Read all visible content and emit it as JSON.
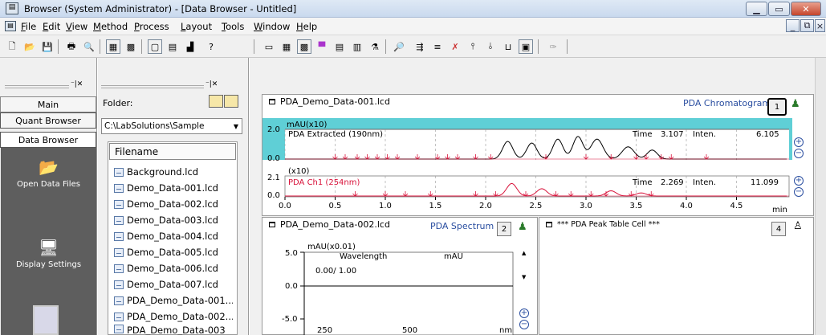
{
  "window": {
    "title": "Browser (System Administrator) - [Data Browser - Untitled]"
  },
  "menu": [
    "File",
    "Edit",
    "View",
    "Method",
    "Process",
    "Layout",
    "Tools",
    "Window",
    "Help"
  ],
  "left_nav": {
    "tabs": [
      "Main",
      "Quant Browser",
      "Data Browser"
    ],
    "buttons": [
      "Open Data Files",
      "Display Settings"
    ]
  },
  "folder": {
    "label": "Folder:",
    "path": "C:\\LabSolutions\\Sample",
    "header": "Filename",
    "files": [
      "Background.lcd",
      "Demo_Data-001.lcd",
      "Demo_Data-002.lcd",
      "Demo_Data-003.lcd",
      "Demo_Data-004.lcd",
      "Demo_Data-005.lcd",
      "Demo_Data-006.lcd",
      "Demo_Data-007.lcd",
      "PDA_Demo_Data-001...",
      "PDA_Demo_Data-002...",
      "PDA_Demo_Data-003"
    ]
  },
  "chromatogram": {
    "file": "PDA_Demo_Data-001.lcd",
    "type": "PDA Chromatogram",
    "cell": "1",
    "trace1": {
      "unit": "mAU(x10)",
      "label": "PDA Extracted (190nm)",
      "time_label": "Time",
      "time": "3.107",
      "inten_label": "Inten.",
      "inten": "6.105",
      "ymax": "2.0",
      "ymin": "0.0"
    },
    "trace2": {
      "unit": "(x10)",
      "label": "PDA Ch1 (254nm)",
      "time_label": "Time",
      "time": "2.269",
      "inten_label": "Inten.",
      "inten": "11.099",
      "ymax": "2.1",
      "ymin": "0.0"
    },
    "xticks": [
      "0.0",
      "0.5",
      "1.0",
      "1.5",
      "2.0",
      "2.5",
      "3.0",
      "3.5",
      "4.0",
      "4.5"
    ],
    "xunit": "min"
  },
  "spectrum": {
    "file": "PDA_Demo_Data-002.lcd",
    "type": "PDA Spectrum",
    "cell": "2",
    "unit": "mAU(x0.01)",
    "col1": "Wavelength",
    "col2": "mAU",
    "value": "0.00/ 1.00",
    "yticks": [
      "5.0",
      "0.0",
      "-5.0"
    ],
    "xticks": [
      "250",
      "500"
    ],
    "xunit": "nm"
  },
  "peak_table": {
    "title": "*** PDA Peak Table Cell ***",
    "cell": "4"
  },
  "colors": {
    "cyan_band": "#5fcfd6",
    "red_trace": "#d8123a",
    "blue_text": "#2a4ea0"
  }
}
